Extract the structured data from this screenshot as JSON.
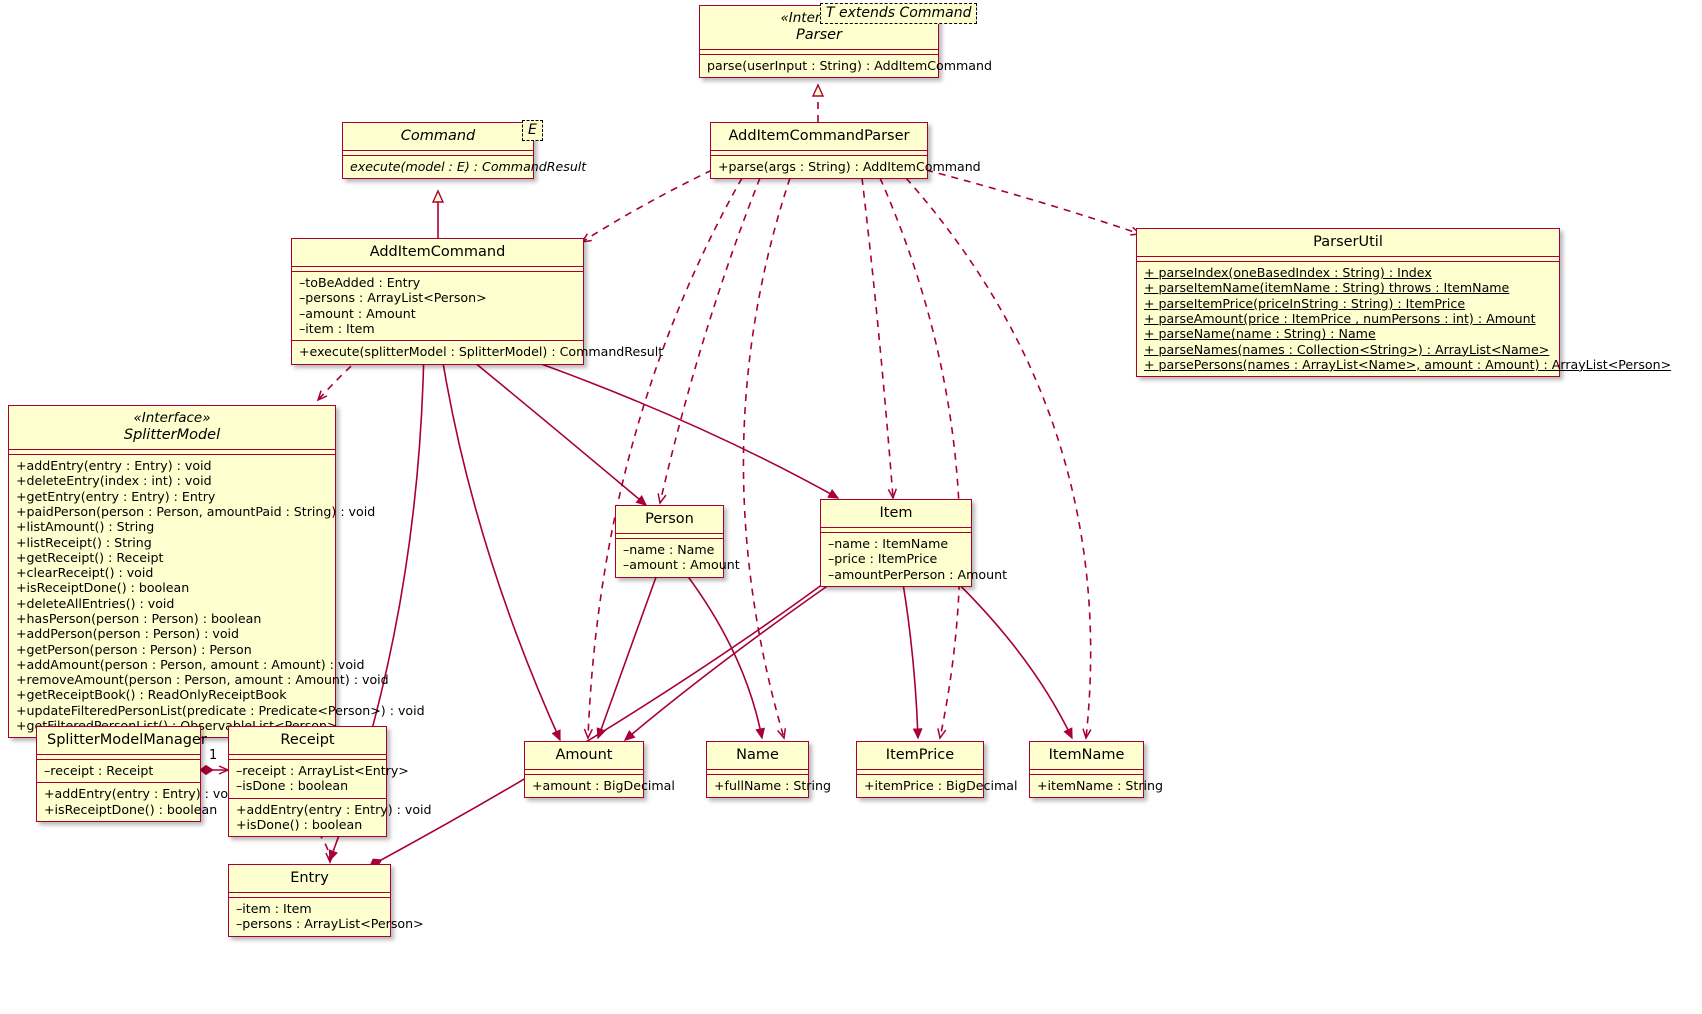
{
  "diagram": {
    "type": "uml-class-diagram",
    "colors": {
      "box_fill": "#FEFECE",
      "box_border": "#A80036",
      "line": "#A80036",
      "text": "#000000",
      "background": "#FFFFFF"
    }
  },
  "classes": [
    {
      "id": "parser",
      "stereotype": "«Interface»",
      "name": "Parser",
      "generic": "T extends Command",
      "fields": [],
      "methods": [
        "parse(userInput : String) : AddItemCommand"
      ]
    },
    {
      "id": "command",
      "stereotype": "",
      "name": "Command",
      "generic": "E",
      "fields": [],
      "methods": [
        "execute(model : E) : CommandResult"
      ]
    },
    {
      "id": "additemcommandparser",
      "stereotype": "",
      "name": "AddItemCommandParser",
      "generic": "",
      "fields": [],
      "methods": [
        "+parse(args : String) : AddItemCommand"
      ]
    },
    {
      "id": "additemcommand",
      "stereotype": "",
      "name": "AddItemCommand",
      "generic": "",
      "fields": [
        "–toBeAdded : Entry",
        "–persons : ArrayList<Person>",
        "–amount : Amount",
        "–item : Item"
      ],
      "methods": [
        "+execute(splitterModel : SplitterModel) : CommandResult"
      ]
    },
    {
      "id": "parserutil",
      "stereotype": "",
      "name": "ParserUtil",
      "generic": "",
      "fields": [],
      "methods": [
        "+ parseIndex(oneBasedIndex : String) : Index",
        "+ parseItemName(itemName : String) throws : ItemName",
        "+ parseItemPrice(priceInString : String) : ItemPrice",
        "+ parseAmount(price : ItemPrice , numPersons : int) : Amount",
        "+ parseName(name : String) : Name",
        "+ parseNames(names : Collection<String>) : ArrayList<Name>",
        "+ parsePersons(names : ArrayList<Name>, amount : Amount) : ArrayList<Person>"
      ]
    },
    {
      "id": "splittermodel",
      "stereotype": "«Interface»",
      "name": "SplitterModel",
      "generic": "",
      "fields": [],
      "methods": [
        "+addEntry(entry : Entry) : void",
        "+deleteEntry(index : int) : void",
        "+getEntry(entry : Entry) : Entry",
        "+paidPerson(person : Person, amountPaid : String) : void",
        "+listAmount() : String",
        "+listReceipt() : String",
        "+getReceipt() : Receipt",
        "+clearReceipt() : void",
        "+isReceiptDone() : boolean",
        "+deleteAllEntries() : void",
        "+hasPerson(person : Person) : boolean",
        "+addPerson(person : Person) : void",
        "+getPerson(person : Person) : Person",
        "+addAmount(person : Person, amount : Amount) : void",
        "+removeAmount(person : Person, amount : Amount) : void",
        "+getReceiptBook() : ReadOnlyReceiptBook",
        "+updateFilteredPersonList(predicate : Predicate<Person>) : void",
        "+getFilteredPersonList() : ObservableList<Person>"
      ]
    },
    {
      "id": "splittermodelmanager",
      "stereotype": "",
      "name": "SplitterModelManager",
      "generic": "",
      "fields": [
        "–receipt : Receipt"
      ],
      "methods": [
        "+addEntry(entry : Entry) : void",
        "+isReceiptDone() : boolean"
      ]
    },
    {
      "id": "receipt",
      "stereotype": "",
      "name": "Receipt",
      "generic": "",
      "fields": [
        "–receipt : ArrayList<Entry>",
        "–isDone : boolean"
      ],
      "methods": [
        "+addEntry(entry : Entry) : void",
        "+isDone() : boolean"
      ]
    },
    {
      "id": "entry",
      "stereotype": "",
      "name": "Entry",
      "generic": "",
      "fields": [
        "–item : Item",
        "–persons : ArrayList<Person>"
      ],
      "methods": []
    },
    {
      "id": "person",
      "stereotype": "",
      "name": "Person",
      "generic": "",
      "fields": [
        "–name : Name",
        "–amount : Amount"
      ],
      "methods": []
    },
    {
      "id": "item",
      "stereotype": "",
      "name": "Item",
      "generic": "",
      "fields": [
        "–name : ItemName",
        "–price : ItemPrice",
        "–amountPerPerson : Amount"
      ],
      "methods": []
    },
    {
      "id": "amount",
      "stereotype": "",
      "name": "Amount",
      "generic": "",
      "fields": [],
      "methods": [
        "+amount : BigDecimal"
      ]
    },
    {
      "id": "name",
      "stereotype": "",
      "name": "Name",
      "generic": "",
      "fields": [],
      "methods": [
        "+fullName : String"
      ]
    },
    {
      "id": "itemprice",
      "stereotype": "",
      "name": "ItemPrice",
      "generic": "",
      "fields": [],
      "methods": [
        "+itemPrice : BigDecimal"
      ]
    },
    {
      "id": "itemname",
      "stereotype": "",
      "name": "ItemName",
      "generic": "",
      "fields": [],
      "methods": [
        "+itemName : String"
      ]
    }
  ],
  "multiplicities": [
    {
      "id": "mgr-receipt",
      "label": "1"
    }
  ]
}
